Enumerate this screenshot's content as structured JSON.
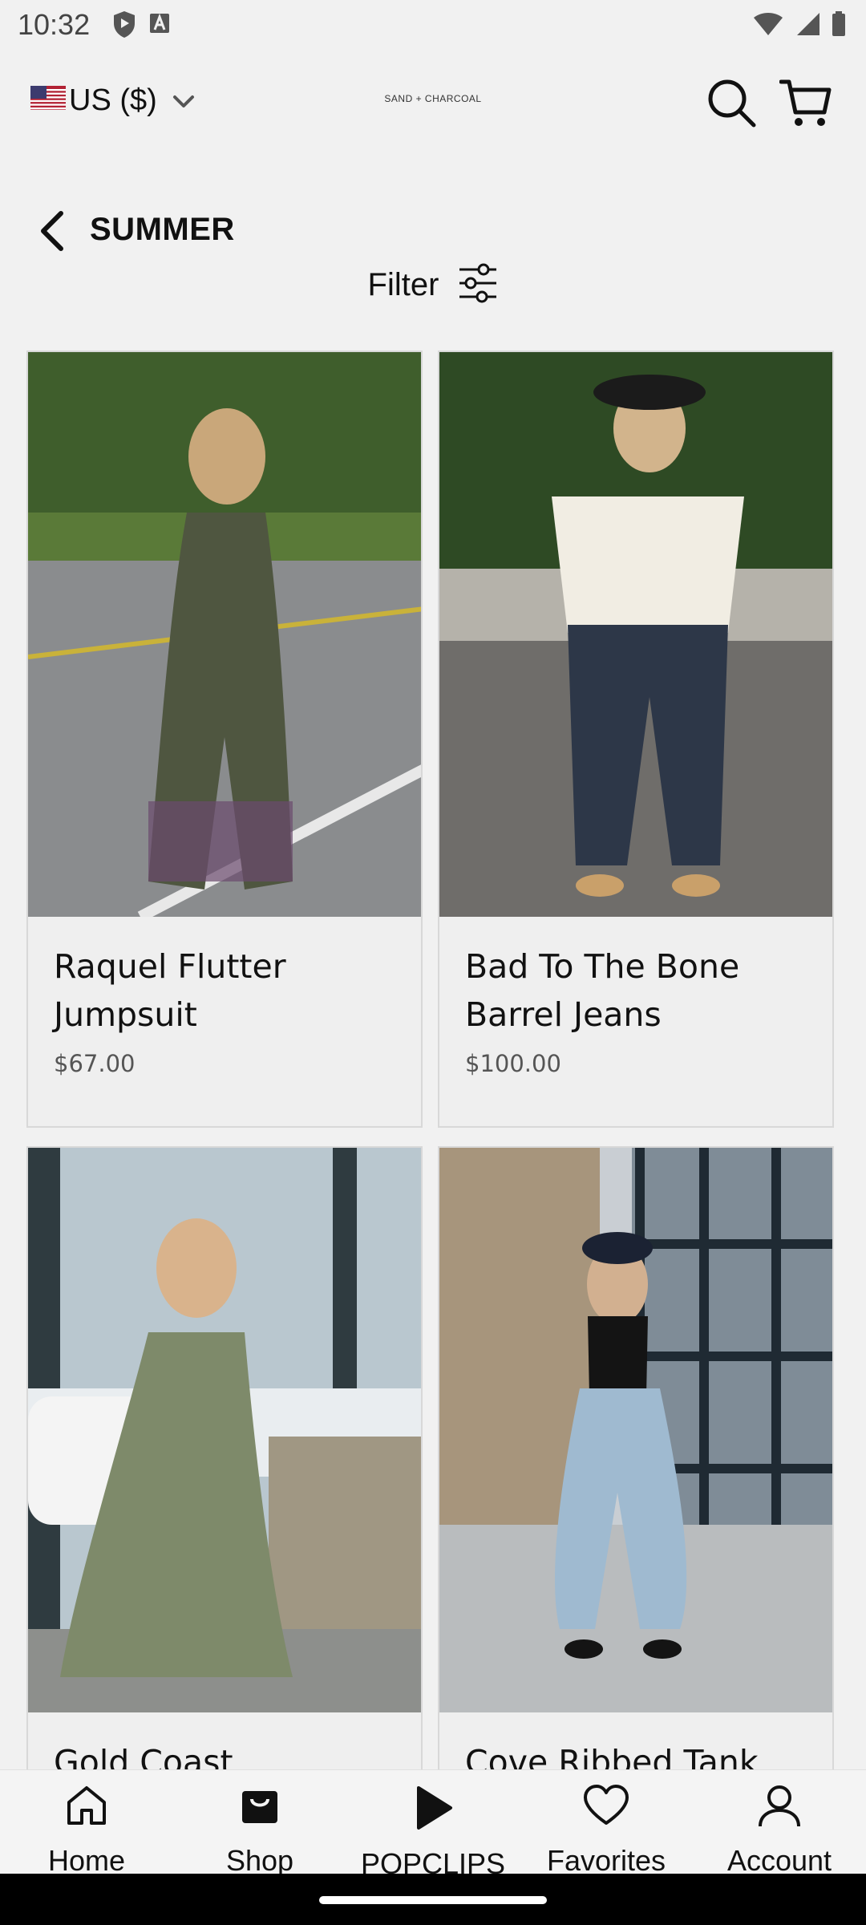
{
  "status_bar": {
    "time": "10:32",
    "icons_left": [
      "shield-play-icon",
      "font-a-icon"
    ],
    "icons_right": [
      "wifi-icon",
      "signal-icon",
      "battery-icon"
    ]
  },
  "header": {
    "currency": "US ($)",
    "logo_text": "SAND + CHARCOAL",
    "icons": [
      "search-icon",
      "cart-icon"
    ]
  },
  "collection": {
    "title": "SUMMER",
    "filter_label": "Filter"
  },
  "products": [
    {
      "name": "Raquel Flutter Jumpsuit",
      "price": "$67.00"
    },
    {
      "name": "Bad To The Bone Barrel Jeans",
      "price": "$100.00"
    },
    {
      "name": "Gold Coast",
      "price": ""
    },
    {
      "name": "Cove Ribbed Tank",
      "price": ""
    }
  ],
  "bottom_nav": {
    "items": [
      {
        "label": "Home",
        "icon": "home-icon"
      },
      {
        "label": "Shop",
        "icon": "shopping-bag-icon"
      },
      {
        "label": "POPCLIPS",
        "icon": "play-icon"
      },
      {
        "label": "Favorites",
        "icon": "heart-icon"
      },
      {
        "label": "Account",
        "icon": "person-icon"
      }
    ]
  },
  "colors": {
    "background": "#f1f1f1",
    "text": "#111111",
    "price": "#555555"
  }
}
